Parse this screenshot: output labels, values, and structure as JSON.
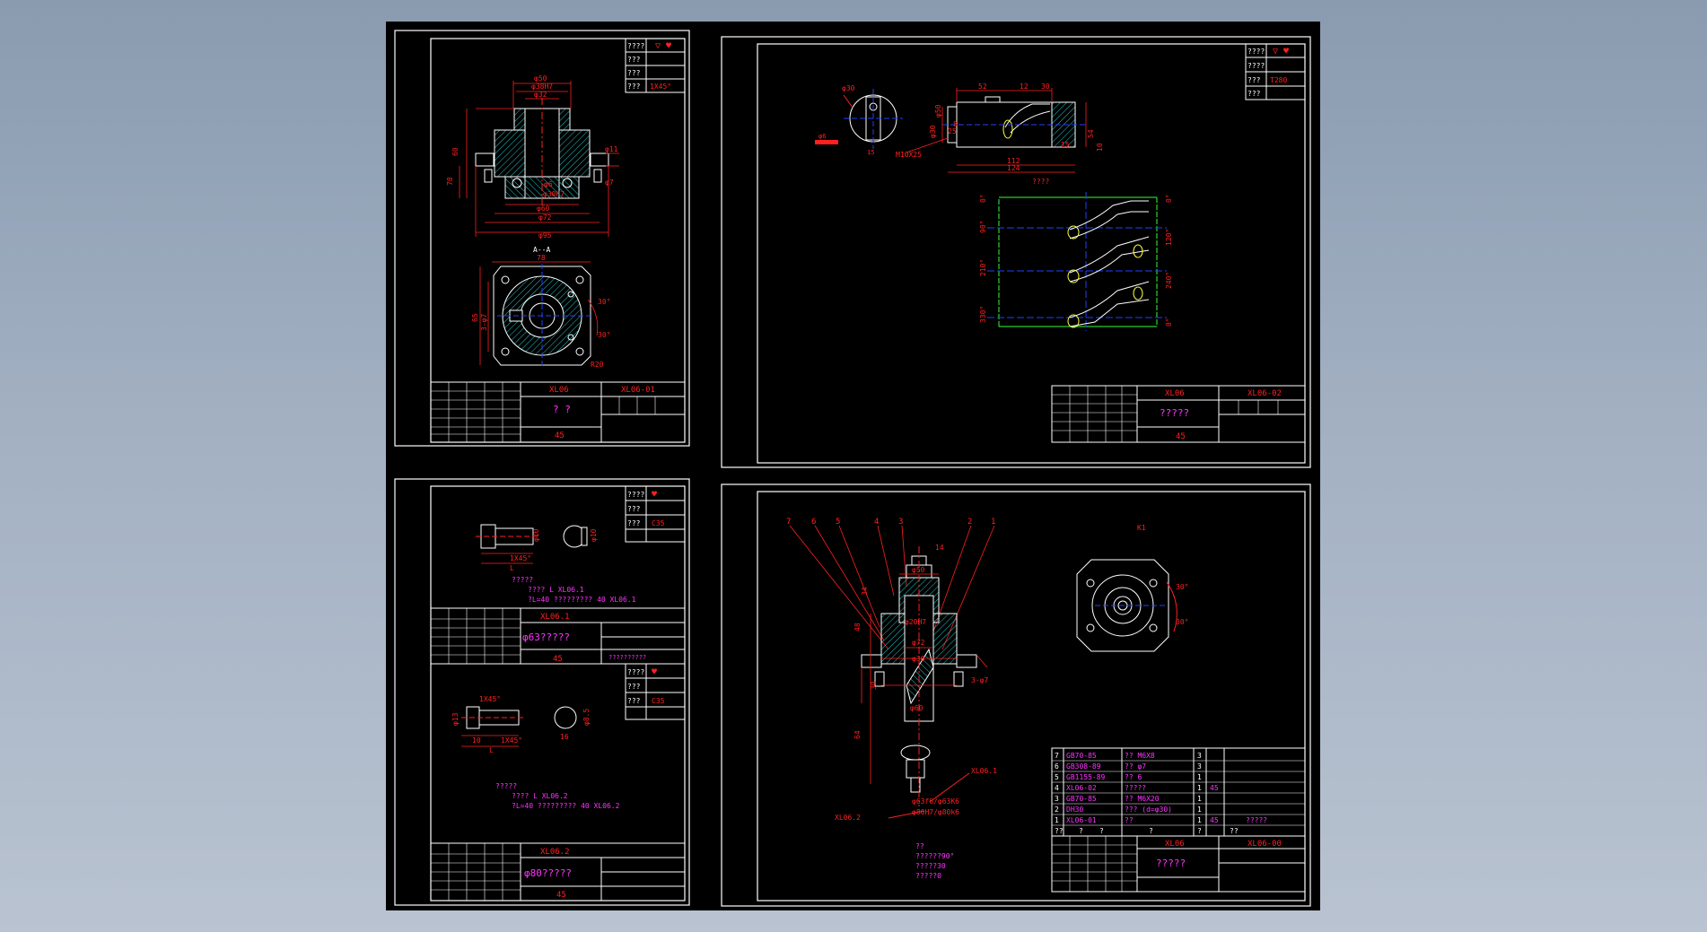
{
  "colors": {
    "background": "#8a9bb0",
    "canvas": "#000000",
    "frame": "#ffffff",
    "dimension": "#ff2020",
    "section_hatch": "#22c4c4",
    "centerline": "#2040ff",
    "note_text": "#ff33ff",
    "geometry": "#ffffff",
    "hidden_line": "#ffff40",
    "cam_curve": "#33ff33"
  },
  "sheet1": {
    "title_block": {
      "part_code": "XL06",
      "drawing_no": "XL06-01",
      "name": "? ?",
      "material": "45"
    },
    "roughness_block": [
      "????",
      "???",
      "???",
      "???"
    ],
    "chamfer_note": "1X45°",
    "section_label": "A--A",
    "dims": {
      "d50": "φ50",
      "d38": "φ38H7",
      "d32": "φ32",
      "d30": "φ30H7",
      "d60": "φ60",
      "d72": "φ72",
      "d95": "φ95",
      "d11": "φ11",
      "d7": "φ7",
      "d6": "φ6",
      "h60": "60",
      "h78": "78",
      "w78": "78",
      "h65": "65",
      "hole3": "3-φ7",
      "a30": "30°",
      "a30b": "30°",
      "r20": "R20"
    }
  },
  "sheet2": {
    "title_block": {
      "part_code": "XL06",
      "drawing_no": "XL06-02",
      "name": "?????",
      "material": "45"
    },
    "roughness_block": [
      "????",
      "????",
      "???",
      "???"
    ],
    "roughness_value": "T280",
    "dims": {
      "d52": "52",
      "d12": "12",
      "d30": "30",
      "l112": "112",
      "l124": "124",
      "m10": "M10X25",
      "d8": "8",
      "d6": "φ6",
      "d30b": "φ30",
      "d50": "φ50",
      "d54": "54",
      "d10": "10",
      "d15": "15",
      "d30c": "φ30",
      "d15b": "15",
      "d25": "25"
    },
    "development_label": "????",
    "angles_left": [
      "0°",
      "90°",
      "210°",
      "330°"
    ],
    "angles_right": [
      "0°",
      "120°",
      "240°",
      "0°"
    ]
  },
  "sheet3": {
    "part_a": {
      "title_block": {
        "part_code": "XL06.1",
        "name": "φ63?????",
        "material": "45"
      },
      "roughness_block": [
        "????",
        "???",
        "???"
      ],
      "hardness": "C35",
      "chamfer": "1X45°",
      "dims": {
        "d10": "φ10",
        "d10b": "φ10",
        "l": "L"
      },
      "notes": [
        "?????",
        "???? L  XL06.1",
        "?L=40  ????????? 40  XL06.1"
      ],
      "mark": "??????????"
    },
    "part_b": {
      "title_block": {
        "part_code": "XL06.2",
        "name": "φ80?????",
        "material": "45"
      },
      "roughness_block": [
        "????",
        "???",
        "???"
      ],
      "hardness": "C35",
      "chamfer": "1X45°",
      "chamfer2": "1X45°",
      "dims": {
        "d13": "φ13",
        "d10": "10",
        "d16": "16",
        "d85": "φ8.5",
        "l": "L"
      },
      "notes": [
        "?????",
        "???? L  XL06.2",
        "?L=40  ????????? 40  XL06.2"
      ]
    }
  },
  "sheet4": {
    "title_block": {
      "part_code": "XL06",
      "drawing_no": "XL06-00",
      "name": "?????",
      "material": ""
    },
    "view_label": "K1",
    "balloons": [
      "7",
      "6",
      "5",
      "4",
      "3",
      "2",
      "1"
    ],
    "bom": [
      {
        "no": "7",
        "std": "GB70-85",
        "name": "?? M6X8",
        "qty": "3",
        "mat": ""
      },
      {
        "no": "6",
        "std": "GB308-89",
        "name": "?? φ7",
        "qty": "3",
        "mat": ""
      },
      {
        "no": "5",
        "std": "GB1155-89",
        "name": "?? 6",
        "qty": "1",
        "mat": ""
      },
      {
        "no": "4",
        "std": "XL06-02",
        "name": "?????",
        "qty": "1",
        "mat": "45"
      },
      {
        "no": "3",
        "std": "GB70-85",
        "name": "?? M6X20",
        "qty": "1",
        "mat": ""
      },
      {
        "no": "2",
        "std": "DH30",
        "name": "??? (d=φ30)",
        "qty": "1",
        "mat": ""
      },
      {
        "no": "1",
        "std": "XL06-01",
        "name": "??",
        "qty": "1",
        "mat": "45"
      }
    ],
    "bom_note": "?????",
    "bom_header": [
      "??",
      "?",
      "?",
      "?",
      "?",
      "??"
    ],
    "notes": [
      "??",
      "??????90°",
      "?????30",
      "?????0"
    ],
    "refs": {
      "r1": "XL06.1",
      "r2": "XL06.2",
      "fit1": "φ63f6/φ63K6",
      "fit2": "φ80H7/φ80k6"
    },
    "dims": {
      "d50": "φ50",
      "d20": "φ20H7",
      "d72": "φ72",
      "d30": "φ30",
      "d60": "φ60",
      "h3": "3-φ7",
      "a30": "30°",
      "a30b": "30°",
      "v14": "14",
      "v48": "48",
      "v30": "30",
      "v64": "64",
      "v34": "34"
    }
  }
}
